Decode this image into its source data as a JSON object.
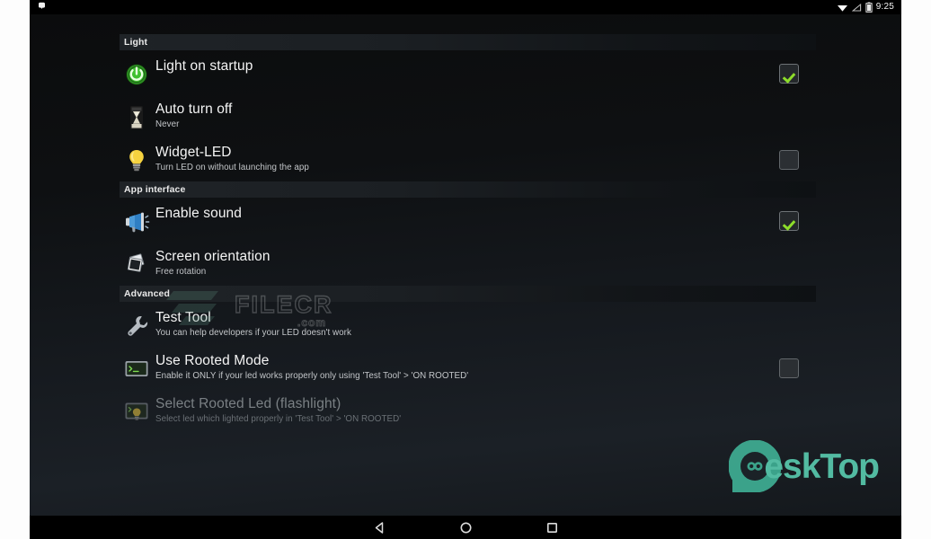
{
  "status_bar": {
    "notification_icon": "notification-dot-icon",
    "icons": [
      "wifi-signal-icon",
      "cellular-signal-icon",
      "battery-icon"
    ],
    "clock": "9:25"
  },
  "sections": [
    {
      "header": "Light",
      "name": "section-light",
      "rows": [
        {
          "name": "pref-light-on-startup",
          "icon": "power-button-icon",
          "title": "Light on startup",
          "summary": "",
          "widget": "checkbox",
          "checked": true,
          "disabled": false
        },
        {
          "name": "pref-auto-turn-off",
          "icon": "hourglass-icon",
          "title": "Auto turn off",
          "summary": "Never",
          "widget": "none",
          "checked": false,
          "disabled": false
        },
        {
          "name": "pref-widget-led",
          "icon": "lightbulb-icon",
          "title": "Widget-LED",
          "summary": "Turn LED on without launching the app",
          "widget": "checkbox",
          "checked": false,
          "disabled": false
        }
      ]
    },
    {
      "header": "App interface",
      "name": "section-app-interface",
      "rows": [
        {
          "name": "pref-enable-sound",
          "icon": "megaphone-icon",
          "title": "Enable sound",
          "summary": "",
          "widget": "checkbox",
          "checked": true,
          "disabled": false
        },
        {
          "name": "pref-screen-orientation",
          "icon": "photo-stack-icon",
          "title": "Screen orientation",
          "summary": "Free rotation",
          "widget": "none",
          "checked": false,
          "disabled": false
        }
      ]
    },
    {
      "header": "Advanced",
      "name": "section-advanced",
      "rows": [
        {
          "name": "pref-test-tool",
          "icon": "wrench-icon",
          "title": "Test Tool",
          "summary": "You can help developers if your LED doesn't work",
          "widget": "none",
          "checked": false,
          "disabled": false
        },
        {
          "name": "pref-use-rooted-mode",
          "icon": "terminal-icon",
          "title": "Use Rooted Mode",
          "summary": "Enable it ONLY if your led works properly only using 'Test Tool' > 'ON ROOTED'",
          "widget": "checkbox",
          "checked": false,
          "disabled": false
        },
        {
          "name": "pref-select-rooted-led",
          "icon": "terminal-bulb-icon",
          "title": "Select Rooted Led (flashlight)",
          "summary": "Select led which lighted properly in 'Test Tool' > 'ON ROOTED'",
          "widget": "none",
          "checked": false,
          "disabled": true
        }
      ]
    }
  ],
  "watermarks": {
    "filecr": {
      "text": "FILECR",
      "suffix": ".com",
      "name": "filecr-watermark"
    },
    "desktop": {
      "text": "eskTop",
      "name": "desktop-watermark",
      "color": "#58c9ad"
    }
  },
  "nav_bar": {
    "back": "back-triangle-icon",
    "home": "home-circle-icon",
    "recents": "recents-square-icon"
  },
  "colors": {
    "accent_check": "#8ddd2a",
    "power_green": "#3ab02c",
    "bulb_yellow": "#f2cf4a",
    "watermark_teal": "#58c9ad"
  }
}
